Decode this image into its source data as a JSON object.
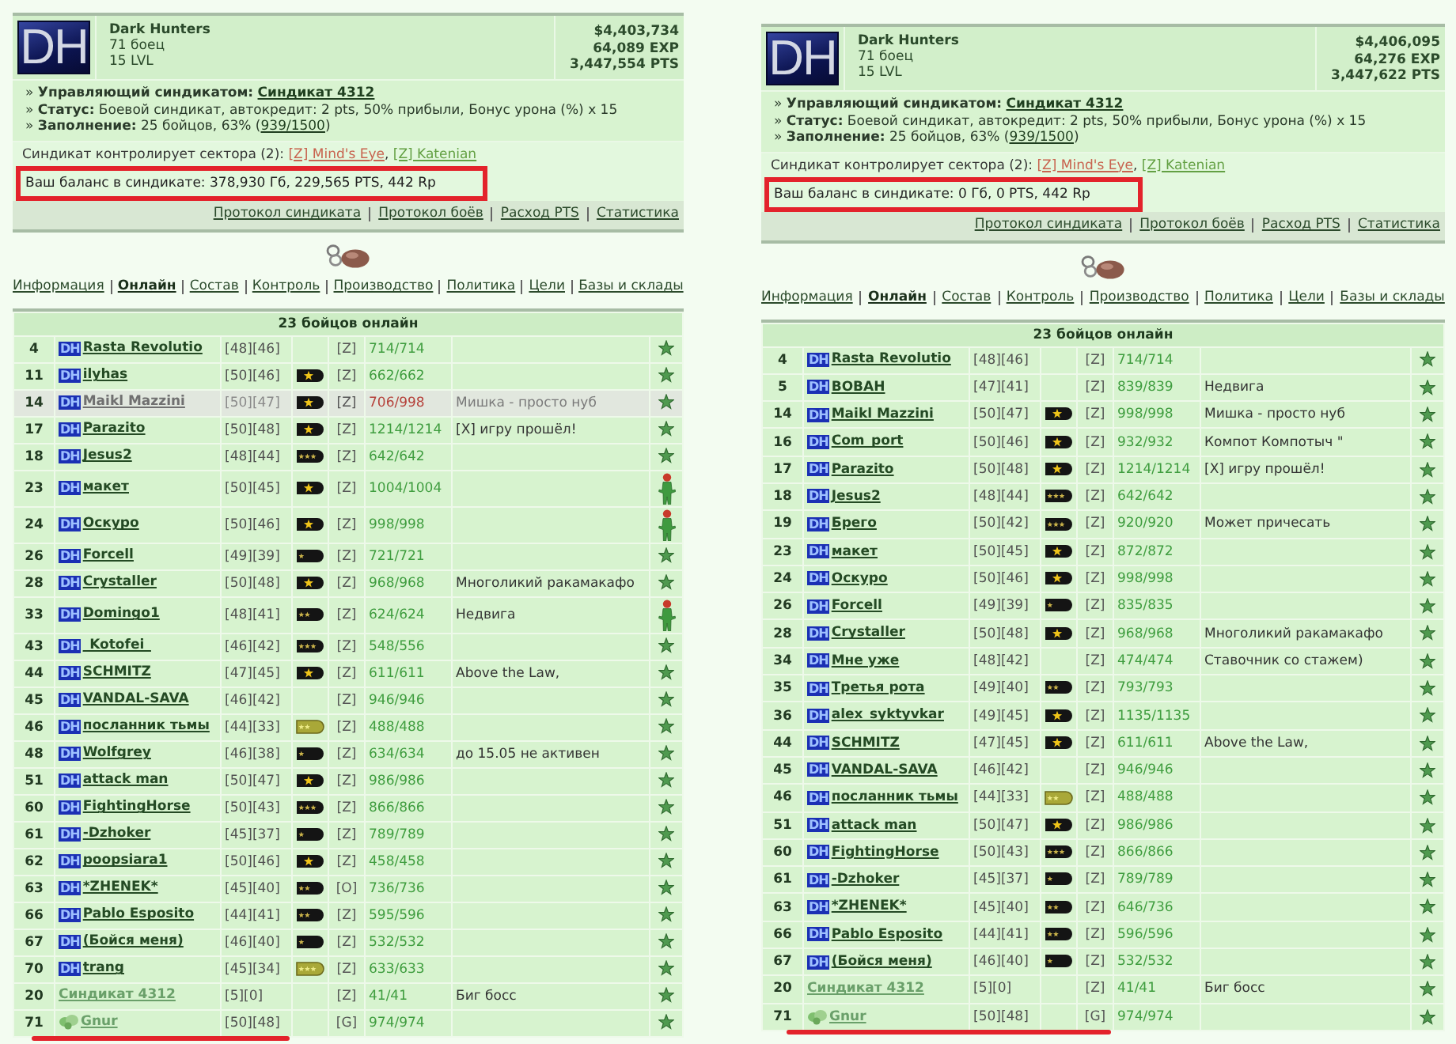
{
  "panels": [
    {
      "header": {
        "logo": "DH",
        "name": "Dark Hunters",
        "members": "71 боец",
        "level": "15 LVL",
        "money": "$4,403,734",
        "exp": "64,089 EXP",
        "pts": "3,447,554 PTS"
      },
      "info": [
        {
          "text": "» **Управляющий синдикатом:** ",
          "link": {
            "text": "Синдикат 4312",
            "strong": true
          }
        },
        {
          "text": "» **Статус:** Боевой синдикат, автокредит: 2 pts, 50% прибыли, Бонус урона (%) x 15"
        },
        {
          "text": "» **Заполнение:** 25 бойцов, 63% (",
          "link": {
            "text": "939/1500",
            "strong": false
          },
          "after": ")"
        }
      ],
      "sectors": {
        "text": "Синдикат контролирует сектора (2): ",
        "links": [
          {
            "label": "[Z] Mind's Eye",
            "color": "#c8634f",
            "after": ", "
          },
          {
            "label": "[Z] Katenian",
            "color": "#63a043"
          }
        ]
      },
      "balance": {
        "text": "Ваш баланс в синдикате: 378,930 Гб, 229,565 PTS, 442 Rp",
        "highlighted": true
      },
      "links": [
        "Протокол синдиката",
        "Протокол боёв",
        "Расход PTS",
        "Статистика"
      ],
      "nav": [
        {
          "label": "Информация",
          "selected": false
        },
        {
          "label": "Онлайн",
          "selected": true
        },
        {
          "label": "Состав",
          "selected": false
        },
        {
          "label": "Контроль",
          "selected": false
        },
        {
          "label": "Производство",
          "selected": false
        },
        {
          "label": "Политика",
          "selected": false
        },
        {
          "label": "Цели",
          "selected": false
        },
        {
          "label": "Базы и склады",
          "selected": false
        }
      ],
      "table": {
        "title": "23 бойцов онлайн",
        "underline_last_row": true,
        "rows": [
          {
            "number": "4",
            "kind": "member",
            "tag": "DH",
            "name": "Rasta Revolutio",
            "levels": "[48][46]",
            "sector": "[Z]",
            "hp": "714/714",
            "status": {
              "kind": "star"
            }
          },
          {
            "number": "11",
            "kind": "member",
            "tag": "DH",
            "name": "ilyhas",
            "levels": "[50][46]",
            "rank": {
              "kind": "gold"
            },
            "sector": "[Z]",
            "hp": "662/662",
            "status": {
              "kind": "star"
            }
          },
          {
            "number": "14",
            "kind": "inactive",
            "tag": "DH",
            "name": "Maikl Mazzini",
            "levels": "[50][47]",
            "rank": {
              "kind": "gold"
            },
            "sector": "[Z]",
            "hp": "706/998",
            "comment": "Мишка - просто нуб",
            "status": {
              "kind": "star"
            }
          },
          {
            "number": "17",
            "kind": "member",
            "tag": "DH",
            "name": "Parazito",
            "levels": "[50][48]",
            "rank": {
              "kind": "gold"
            },
            "sector": "[Z]",
            "hp": "1214/1214",
            "comment": "[X] игру прошёл!",
            "status": {
              "kind": "star"
            }
          },
          {
            "number": "18",
            "kind": "member",
            "tag": "DH",
            "name": "Jesus2",
            "levels": "[48][44]",
            "rank": {
              "kind": "threestar"
            },
            "sector": "[Z]",
            "hp": "642/642",
            "status": {
              "kind": "star"
            }
          },
          {
            "number": "23",
            "kind": "member",
            "tag": "DH",
            "name": "макет",
            "levels": "[50][45]",
            "rank": {
              "kind": "gold"
            },
            "sector": "[Z]",
            "hp": "1004/1004",
            "status": {
              "kind": "figure"
            }
          },
          {
            "number": "24",
            "kind": "member",
            "tag": "DH",
            "name": "Оскуро",
            "levels": "[50][46]",
            "rank": {
              "kind": "gold"
            },
            "sector": "[Z]",
            "hp": "998/998",
            "status": {
              "kind": "figure"
            }
          },
          {
            "number": "26",
            "kind": "member",
            "tag": "DH",
            "name": "Forcell",
            "levels": "[49][39]",
            "rank": {
              "kind": "onestar"
            },
            "sector": "[Z]",
            "hp": "721/721",
            "status": {
              "kind": "star"
            }
          },
          {
            "number": "28",
            "kind": "member",
            "tag": "DH",
            "name": "Crystaller",
            "levels": "[50][48]",
            "rank": {
              "kind": "gold"
            },
            "sector": "[Z]",
            "hp": "968/968",
            "comment": "Многоликий ракамакафо",
            "status": {
              "kind": "star"
            }
          },
          {
            "number": "33",
            "kind": "member",
            "tag": "DH",
            "name": "Domingo1",
            "levels": "[48][41]",
            "rank": {
              "kind": "twostar"
            },
            "sector": "[Z]",
            "hp": "624/624",
            "comment": "Недвига",
            "status": {
              "kind": "figure"
            }
          },
          {
            "number": "43",
            "kind": "member",
            "tag": "DH",
            "name": "_Kotofei_",
            "levels": "[46][42]",
            "rank": {
              "kind": "threestar"
            },
            "sector": "[Z]",
            "hp": "548/556",
            "status": {
              "kind": "star"
            }
          },
          {
            "number": "44",
            "kind": "member",
            "tag": "DH",
            "name": "SCHMITZ",
            "levels": "[47][45]",
            "rank": {
              "kind": "gold"
            },
            "sector": "[Z]",
            "hp": "611/611",
            "comment": "Above the Law,",
            "status": {
              "kind": "star"
            }
          },
          {
            "number": "45",
            "kind": "member",
            "tag": "DH",
            "name": "VANDAL-SAVA",
            "levels": "[46][42]",
            "sector": "[Z]",
            "hp": "946/946",
            "status": {
              "kind": "star"
            }
          },
          {
            "number": "46",
            "kind": "member",
            "tag": "DH",
            "name": "посланник тьмы",
            "levels": "[44][33]",
            "rank": {
              "kind": "olivetwo"
            },
            "sector": "[Z]",
            "hp": "488/488",
            "status": {
              "kind": "star"
            }
          },
          {
            "number": "48",
            "kind": "member",
            "tag": "DH",
            "name": "Wolfgrey",
            "levels": "[46][38]",
            "rank": {
              "kind": "onestar"
            },
            "sector": "[Z]",
            "hp": "634/634",
            "comment": "до 15.05 не активен",
            "status": {
              "kind": "star"
            }
          },
          {
            "number": "51",
            "kind": "member",
            "tag": "DH",
            "name": "attack man",
            "levels": "[50][47]",
            "rank": {
              "kind": "gold"
            },
            "sector": "[Z]",
            "hp": "986/986",
            "status": {
              "kind": "star"
            }
          },
          {
            "number": "60",
            "kind": "member",
            "tag": "DH",
            "name": "FightingHorse",
            "levels": "[50][43]",
            "rank": {
              "kind": "threestar"
            },
            "sector": "[Z]",
            "hp": "866/866",
            "status": {
              "kind": "star"
            }
          },
          {
            "number": "61",
            "kind": "member",
            "tag": "DH",
            "name": "-Dzhoker",
            "levels": "[45][37]",
            "rank": {
              "kind": "onestar"
            },
            "sector": "[Z]",
            "hp": "789/789",
            "status": {
              "kind": "star"
            }
          },
          {
            "number": "62",
            "kind": "member",
            "tag": "DH",
            "name": "poopsiara1",
            "levels": "[50][46]",
            "rank": {
              "kind": "gold"
            },
            "sector": "[Z]",
            "hp": "458/458",
            "status": {
              "kind": "star"
            }
          },
          {
            "number": "63",
            "kind": "member",
            "tag": "DH",
            "name": "*ZHENEK*",
            "levels": "[45][40]",
            "rank": {
              "kind": "twostar"
            },
            "sector": "[O]",
            "hp": "736/736",
            "status": {
              "kind": "star"
            }
          },
          {
            "number": "66",
            "kind": "member",
            "tag": "DH",
            "name": "Pablo Esposito",
            "levels": "[44][41]",
            "rank": {
              "kind": "twostar"
            },
            "sector": "[Z]",
            "hp": "595/596",
            "status": {
              "kind": "star"
            }
          },
          {
            "number": "67",
            "kind": "member",
            "tag": "DH",
            "name": "(Бойся меня)",
            "levels": "[46][40]",
            "rank": {
              "kind": "onestar"
            },
            "sector": "[Z]",
            "hp": "532/532",
            "status": {
              "kind": "star"
            }
          },
          {
            "number": "70",
            "kind": "member",
            "tag": "DH",
            "name": "trang",
            "levels": "[45][34]",
            "rank": {
              "kind": "olivethree"
            },
            "sector": "[Z]",
            "hp": "633/633",
            "status": {
              "kind": "star"
            }
          },
          {
            "number": "20",
            "kind": "guest",
            "name": "Синдикат 4312",
            "levels": "[5][0]",
            "sector": "[Z]",
            "hp": "41/41",
            "comment": "Биг босс",
            "status": {
              "kind": "star"
            }
          },
          {
            "number": "71",
            "kind": "ally",
            "name": "Gnur",
            "levels": "[50][48]",
            "sector": "[G]",
            "hp": "974/974",
            "status": {
              "kind": "star"
            }
          }
        ]
      }
    },
    {
      "header": {
        "logo": "DH",
        "name": "Dark Hunters",
        "members": "71 боец",
        "level": "15 LVL",
        "money": "$4,406,095",
        "exp": "64,276 EXP",
        "pts": "3,447,622 PTS"
      },
      "info": [
        {
          "text": "» **Управляющий синдикатом:** ",
          "link": {
            "text": "Синдикат 4312",
            "strong": true
          }
        },
        {
          "text": "» **Статус:** Боевой синдикат, автокредит: 2 pts, 50% прибыли, Бонус урона (%) x 15"
        },
        {
          "text": "» **Заполнение:** 25 бойцов, 63% (",
          "link": {
            "text": "939/1500",
            "strong": false
          },
          "after": ")"
        }
      ],
      "sectors": {
        "text": "Синдикат контролирует сектора (2): ",
        "links": [
          {
            "label": "[Z] Mind's Eye",
            "color": "#c8634f",
            "after": ", "
          },
          {
            "label": "[Z] Katenian",
            "color": "#63a043"
          }
        ]
      },
      "balance": {
        "text": "Ваш баланс в синдикате: 0 Гб, 0 PTS, 442 Rp",
        "highlighted": true
      },
      "links": [
        "Протокол синдиката",
        "Протокол боёв",
        "Расход PTS",
        "Статистика"
      ],
      "nav": [
        {
          "label": "Информация",
          "selected": false
        },
        {
          "label": "Онлайн",
          "selected": true
        },
        {
          "label": "Состав",
          "selected": false
        },
        {
          "label": "Контроль",
          "selected": false
        },
        {
          "label": "Производство",
          "selected": false
        },
        {
          "label": "Политика",
          "selected": false
        },
        {
          "label": "Цели",
          "selected": false
        },
        {
          "label": "Базы и склады",
          "selected": false
        }
      ],
      "table": {
        "title": "23 бойцов онлайн",
        "underline_last_row": true,
        "rows": [
          {
            "number": "4",
            "kind": "member",
            "tag": "DH",
            "name": "Rasta Revolutio",
            "levels": "[48][46]",
            "sector": "[Z]",
            "hp": "714/714",
            "status": {
              "kind": "star"
            }
          },
          {
            "number": "5",
            "kind": "member",
            "tag": "DH",
            "name": "BOBAH",
            "levels": "[47][41]",
            "sector": "[Z]",
            "hp": "839/839",
            "comment": "Недвига",
            "status": {
              "kind": "star"
            }
          },
          {
            "number": "14",
            "kind": "member",
            "tag": "DH",
            "name": "Maikl Mazzini",
            "levels": "[50][47]",
            "rank": {
              "kind": "gold"
            },
            "sector": "[Z]",
            "hp": "998/998",
            "comment": "Мишка - просто нуб",
            "status": {
              "kind": "star"
            }
          },
          {
            "number": "16",
            "kind": "member",
            "tag": "DH",
            "name": "Com_port",
            "levels": "[50][46]",
            "rank": {
              "kind": "gold"
            },
            "sector": "[Z]",
            "hp": "932/932",
            "comment": "Компот Компотыч \"",
            "status": {
              "kind": "star"
            }
          },
          {
            "number": "17",
            "kind": "member",
            "tag": "DH",
            "name": "Parazito",
            "levels": "[50][48]",
            "rank": {
              "kind": "gold"
            },
            "sector": "[Z]",
            "hp": "1214/1214",
            "comment": "[X] игру прошёл!",
            "status": {
              "kind": "star"
            }
          },
          {
            "number": "18",
            "kind": "member",
            "tag": "DH",
            "name": "Jesus2",
            "levels": "[48][44]",
            "rank": {
              "kind": "threestar"
            },
            "sector": "[Z]",
            "hp": "642/642",
            "status": {
              "kind": "star"
            }
          },
          {
            "number": "19",
            "kind": "member",
            "tag": "DH",
            "name": "Брего",
            "levels": "[50][42]",
            "rank": {
              "kind": "threestar"
            },
            "sector": "[Z]",
            "hp": "920/920",
            "comment": "Может причесать",
            "status": {
              "kind": "star"
            }
          },
          {
            "number": "23",
            "kind": "member",
            "tag": "DH",
            "name": "макет",
            "levels": "[50][45]",
            "rank": {
              "kind": "gold"
            },
            "sector": "[Z]",
            "hp": "872/872",
            "status": {
              "kind": "star"
            }
          },
          {
            "number": "24",
            "kind": "member",
            "tag": "DH",
            "name": "Оскуро",
            "levels": "[50][46]",
            "rank": {
              "kind": "gold"
            },
            "sector": "[Z]",
            "hp": "998/998",
            "status": {
              "kind": "star"
            }
          },
          {
            "number": "26",
            "kind": "member",
            "tag": "DH",
            "name": "Forcell",
            "levels": "[49][39]",
            "rank": {
              "kind": "onestar"
            },
            "sector": "[Z]",
            "hp": "835/835",
            "status": {
              "kind": "star"
            }
          },
          {
            "number": "28",
            "kind": "member",
            "tag": "DH",
            "name": "Crystaller",
            "levels": "[50][48]",
            "rank": {
              "kind": "gold"
            },
            "sector": "[Z]",
            "hp": "968/968",
            "comment": "Многоликий ракамакафо",
            "status": {
              "kind": "star"
            }
          },
          {
            "number": "34",
            "kind": "member",
            "tag": "DH",
            "name": "Мне уже",
            "levels": "[48][42]",
            "sector": "[Z]",
            "hp": "474/474",
            "comment": "Ставочник со стажем)",
            "status": {
              "kind": "star"
            }
          },
          {
            "number": "35",
            "kind": "member",
            "tag": "DH",
            "name": "Третья рота",
            "levels": "[49][40]",
            "rank": {
              "kind": "twostar"
            },
            "sector": "[Z]",
            "hp": "793/793",
            "status": {
              "kind": "star"
            }
          },
          {
            "number": "36",
            "kind": "member",
            "tag": "DH",
            "name": "alex_syktyvkar",
            "levels": "[49][45]",
            "rank": {
              "kind": "gold"
            },
            "sector": "[Z]",
            "hp": "1135/1135",
            "status": {
              "kind": "star"
            }
          },
          {
            "number": "44",
            "kind": "member",
            "tag": "DH",
            "name": "SCHMITZ",
            "levels": "[47][45]",
            "rank": {
              "kind": "gold"
            },
            "sector": "[Z]",
            "hp": "611/611",
            "comment": "Above the Law,",
            "status": {
              "kind": "star"
            }
          },
          {
            "number": "45",
            "kind": "member",
            "tag": "DH",
            "name": "VANDAL-SAVA",
            "levels": "[46][42]",
            "sector": "[Z]",
            "hp": "946/946",
            "status": {
              "kind": "star"
            }
          },
          {
            "number": "46",
            "kind": "member",
            "tag": "DH",
            "name": "посланник тьмы",
            "levels": "[44][33]",
            "rank": {
              "kind": "olivetwo"
            },
            "sector": "[Z]",
            "hp": "488/488",
            "status": {
              "kind": "star"
            }
          },
          {
            "number": "51",
            "kind": "member",
            "tag": "DH",
            "name": "attack man",
            "levels": "[50][47]",
            "rank": {
              "kind": "gold"
            },
            "sector": "[Z]",
            "hp": "986/986",
            "status": {
              "kind": "star"
            }
          },
          {
            "number": "60",
            "kind": "member",
            "tag": "DH",
            "name": "FightingHorse",
            "levels": "[50][43]",
            "rank": {
              "kind": "threestar"
            },
            "sector": "[Z]",
            "hp": "866/866",
            "status": {
              "kind": "star"
            }
          },
          {
            "number": "61",
            "kind": "member",
            "tag": "DH",
            "name": "-Dzhoker",
            "levels": "[45][37]",
            "rank": {
              "kind": "onestar"
            },
            "sector": "[Z]",
            "hp": "789/789",
            "status": {
              "kind": "star"
            }
          },
          {
            "number": "63",
            "kind": "member",
            "tag": "DH",
            "name": "*ZHENEK*",
            "levels": "[45][40]",
            "rank": {
              "kind": "twostar"
            },
            "sector": "[Z]",
            "hp": "646/736",
            "status": {
              "kind": "star"
            }
          },
          {
            "number": "66",
            "kind": "member",
            "tag": "DH",
            "name": "Pablo Esposito",
            "levels": "[44][41]",
            "rank": {
              "kind": "twostar"
            },
            "sector": "[Z]",
            "hp": "596/596",
            "status": {
              "kind": "star"
            }
          },
          {
            "number": "67",
            "kind": "member",
            "tag": "DH",
            "name": "(Бойся меня)",
            "levels": "[46][40]",
            "rank": {
              "kind": "onestar"
            },
            "sector": "[Z]",
            "hp": "532/532",
            "status": {
              "kind": "star"
            }
          },
          {
            "number": "20",
            "kind": "guest",
            "name": "Синдикат 4312",
            "levels": "[5][0]",
            "sector": "[Z]",
            "hp": "41/41",
            "comment": "Биг босс",
            "status": {
              "kind": "star"
            }
          },
          {
            "number": "71",
            "kind": "ally",
            "name": "Gnur",
            "levels": "[50][48]",
            "sector": "[G]",
            "hp": "974/974",
            "status": {
              "kind": "star"
            }
          }
        ]
      }
    }
  ]
}
